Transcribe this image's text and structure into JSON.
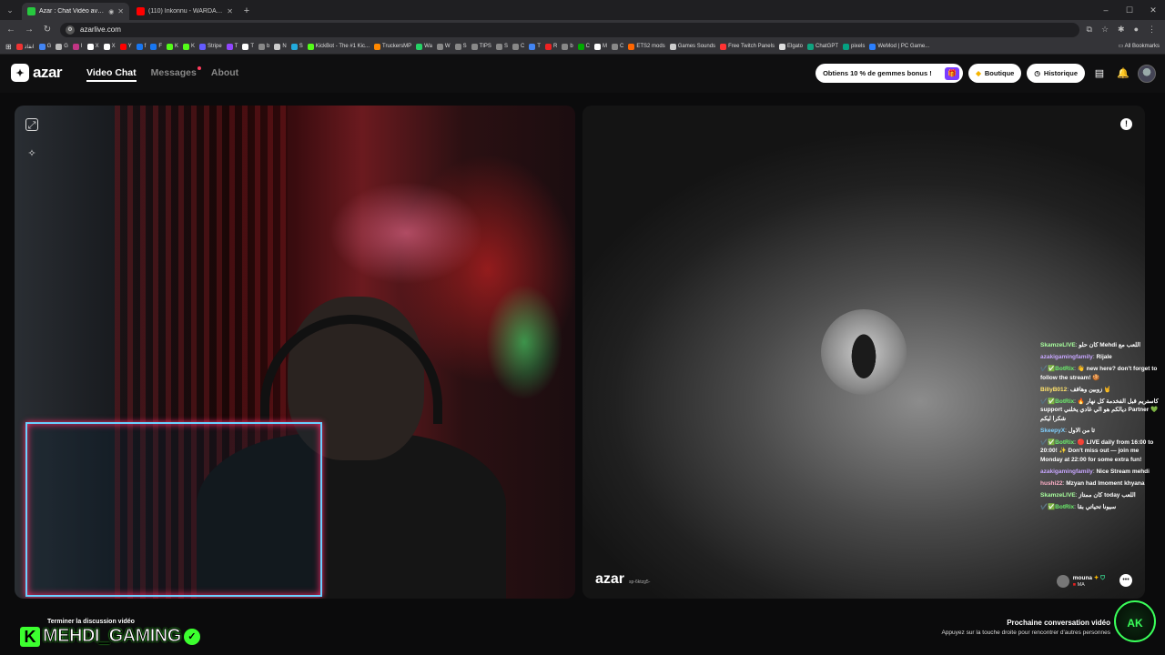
{
  "browser": {
    "tabs": [
      {
        "title": "Azar : Chat Vidéo avec de",
        "active": true,
        "favicon_color": "#27c93f"
      },
      {
        "title": "(110) Inkonnu - WARDA feat M",
        "active": false,
        "favicon_color": "#ff0000"
      }
    ],
    "new_tab": "+",
    "address": "azarlive.com",
    "bookmarks": [
      "انقاذ",
      "G",
      "G",
      "I",
      "X",
      "X",
      "Y",
      "f",
      "F",
      "K",
      "K",
      "Stripe",
      "T",
      "T",
      "b",
      "N",
      "S",
      "KickBot - The #1 Kic...",
      "TruckersMP",
      "Wa",
      "W",
      "S",
      "TIPS",
      "S",
      "C",
      "T",
      "R",
      "b",
      "C",
      "M",
      "C",
      "ETS2 mods",
      "Games Sounds",
      "Free Twitch Panels",
      "Elgato",
      "ChatGPT",
      "pixels",
      "WeMod | PC Game..."
    ],
    "all_bookmarks": "All Bookmarks"
  },
  "app": {
    "logo": "azar",
    "nav": [
      {
        "label": "Video Chat",
        "active": true
      },
      {
        "label": "Messages",
        "active": false,
        "has_dot": true
      },
      {
        "label": "About",
        "active": false
      }
    ],
    "promo": "Obtiens 10 % de gemmes bonus !",
    "shop": "Boutique",
    "history": "Historique"
  },
  "remote": {
    "watermark": "azar",
    "watermark_id": "sp-6ktzg5-",
    "peer_name": "mouna",
    "peer_country": "MA"
  },
  "chat": [
    {
      "user": "SkamzeLIVE",
      "text": "كان حلو Mehdi اللعب مع",
      "color": "#a8ff9e"
    },
    {
      "user": "azakigamingfamily",
      "text": "Rijale",
      "color": "#c7a6ff"
    },
    {
      "user": "✔️✅BotRix",
      "text": "👋 new here? don't forget to follow the stream! 🍪",
      "color": "#6cf06c"
    },
    {
      "user": "BillyB012",
      "text": "زوبين وهاقف 🤘",
      "color": "#ffe26b"
    },
    {
      "user": "✔️✅BotRix",
      "text": "🔥 كاستريم قبل الفخدمة كل نهار support ديالكم هو الي غادي يخلني Partner 💚 شكرا ليكم",
      "color": "#6cf06c"
    },
    {
      "user": "SkeepyX",
      "text": "ثا من الاول",
      "color": "#7fd0ff"
    },
    {
      "user": "✔️✅BotRix",
      "text": "🔴 LIVE daily from 16:00 to 20:00! ✨ Don't miss out — join me Monday at 22:00 for some extra fun!",
      "color": "#6cf06c"
    },
    {
      "user": "azakigamingfamily",
      "text": "Nice Stream mehdi",
      "color": "#c7a6ff"
    },
    {
      "user": "hushi22",
      "text": "Mzyan had lmoment khyana",
      "color": "#ffb0c8"
    },
    {
      "user": "SkamzeLIVE",
      "text": "كان ممتاز today اللعب",
      "color": "#a8ff9e"
    },
    {
      "user": "✔️✅BotRix",
      "text": "سيونا تحياتي بقا",
      "color": "#6cf06c"
    }
  ],
  "bottom": {
    "end_label": "Terminer la discussion vidéo",
    "streamer_name": "MEHDI_GAMING",
    "streamer_badge": "K",
    "next_title": "Prochaine conversation vidéo",
    "next_subtitle": "Appuyez sur la touche droite pour rencontrer d'autres personnes",
    "corner_logo": "AK"
  }
}
